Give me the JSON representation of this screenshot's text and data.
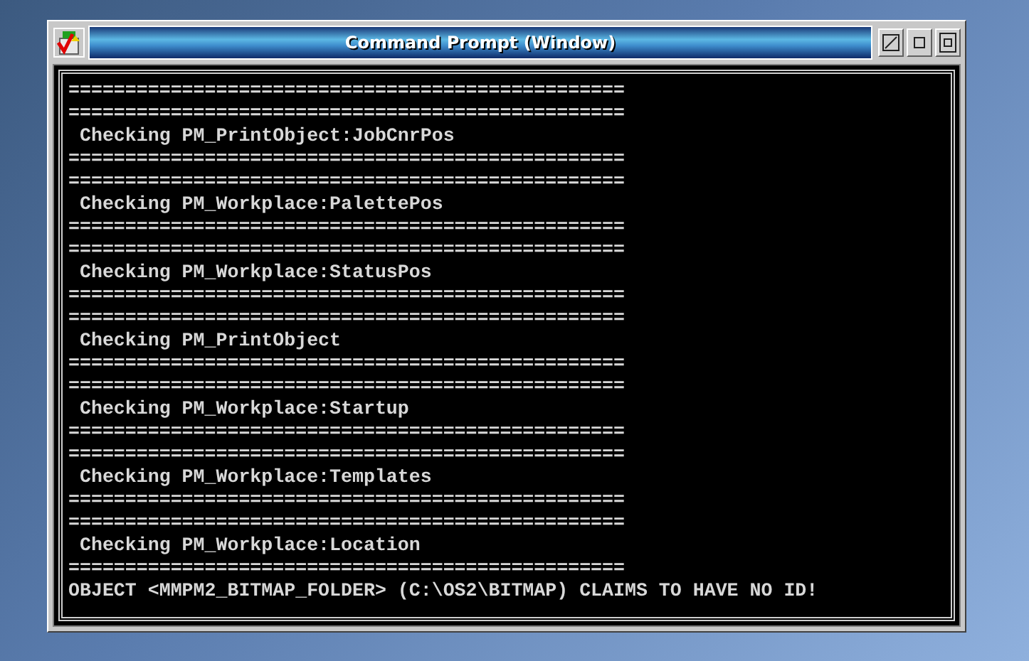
{
  "window": {
    "title": "Command Prompt (Window)"
  },
  "console": {
    "lines": [
      "=================================================",
      "=================================================",
      " Checking PM_PrintObject:JobCnrPos",
      "=================================================",
      "=================================================",
      " Checking PM_Workplace:PalettePos",
      "=================================================",
      "=================================================",
      " Checking PM_Workplace:StatusPos",
      "=================================================",
      "=================================================",
      " Checking PM_PrintObject",
      "=================================================",
      "=================================================",
      " Checking PM_Workplace:Startup",
      "=================================================",
      "=================================================",
      " Checking PM_Workplace:Templates",
      "=================================================",
      "=================================================",
      " Checking PM_Workplace:Location",
      "=================================================",
      "OBJECT <MMPM2_BITMAP_FOLDER> (C:\\OS2\\BITMAP) CLAIMS TO HAVE NO ID!"
    ]
  }
}
